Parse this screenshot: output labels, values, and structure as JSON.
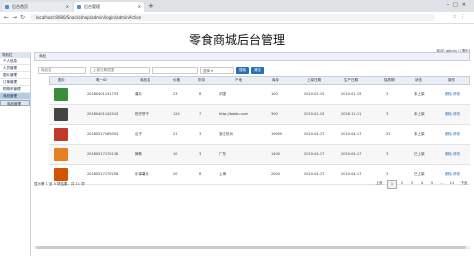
{
  "browser": {
    "tabs": [
      {
        "label": "后台首页"
      },
      {
        "label": "后台管理"
      }
    ],
    "url": "localhost:8080/Snack/shop/admin/login/adminAction"
  },
  "header": {
    "title": "零食商城后台管理",
    "user_info": "欢迎: admin | [退出]"
  },
  "sidebar": {
    "heading": "导航栏",
    "items": [
      {
        "label": "个人信息"
      },
      {
        "label": "人员管理"
      },
      {
        "label": "图片管理"
      },
      {
        "label": "订单管理"
      },
      {
        "label": "购物车管理"
      },
      {
        "label": "商品管理"
      }
    ],
    "sub_item": "商品管理"
  },
  "panel": {
    "title": "商品"
  },
  "search": {
    "name_placeholder": "商品名",
    "date_placeholder": "上架日期范围",
    "status_placeholder": "",
    "select_value": "选择",
    "search_label": "搜索",
    "reset_label": "清空"
  },
  "table": {
    "headers": [
      "图片",
      "唯一ID",
      "商品名",
      "价格",
      "折扣",
      "产地",
      "库存",
      "上架日期",
      "生产日期",
      "保质期",
      "状态",
      "操作"
    ],
    "rows": [
      {
        "id": "20180401141733",
        "name": "薯片",
        "price": "23",
        "discount": "8",
        "origin": "中国",
        "stock": "100",
        "on_date": "2019-02-15",
        "made_date": "2019-01-15",
        "shelf": "3",
        "status": "未上架",
        "ops": "删除 修改",
        "thumb_color": "#3a8d3a"
      },
      {
        "id": "20180401142543",
        "name": "旺仔饼干",
        "price": "124",
        "discount": "7",
        "origin": "http://baidu.com",
        "stock": "300",
        "on_date": "2019-01-15",
        "made_date": "2018-11-11",
        "shelf": "3",
        "status": "未上架",
        "ops": "删除 修改",
        "thumb_color": "#444"
      },
      {
        "id": "20180517165054",
        "name": "瓜子",
        "price": "21",
        "discount": "3",
        "origin": "浙江杭州",
        "stock": "19050",
        "on_date": "2019-04-17",
        "made_date": "2019-04-17",
        "shelf": "31",
        "status": "未上架",
        "ops": "删除 修改",
        "thumb_color": "#c0392b"
      },
      {
        "id": "20180517170136",
        "name": "辣条",
        "price": "10",
        "discount": "3",
        "origin": "广东",
        "stock": "1400",
        "on_date": "2019-04-17",
        "made_date": "2019-04-17",
        "shelf": "3",
        "status": "已上架",
        "ops": "删除 修改",
        "thumb_color": "#e67e22"
      },
      {
        "id": "20180517170258",
        "name": "乐事薯片",
        "price": "20",
        "discount": "8",
        "origin": "上海",
        "stock": "2004",
        "on_date": "2019-04-17",
        "made_date": "2019-04-17",
        "shelf": "3",
        "status": "已上架",
        "ops": "删除 修改",
        "thumb_color": "#d35400"
      }
    ]
  },
  "footer": {
    "summary": "显示第 1 至 5 项结果，共 11 项",
    "pager": {
      "prev": "上页",
      "pages": [
        "1",
        "2",
        "3",
        "4",
        "5",
        "…",
        "11"
      ],
      "next": "下页",
      "current": "1"
    }
  }
}
